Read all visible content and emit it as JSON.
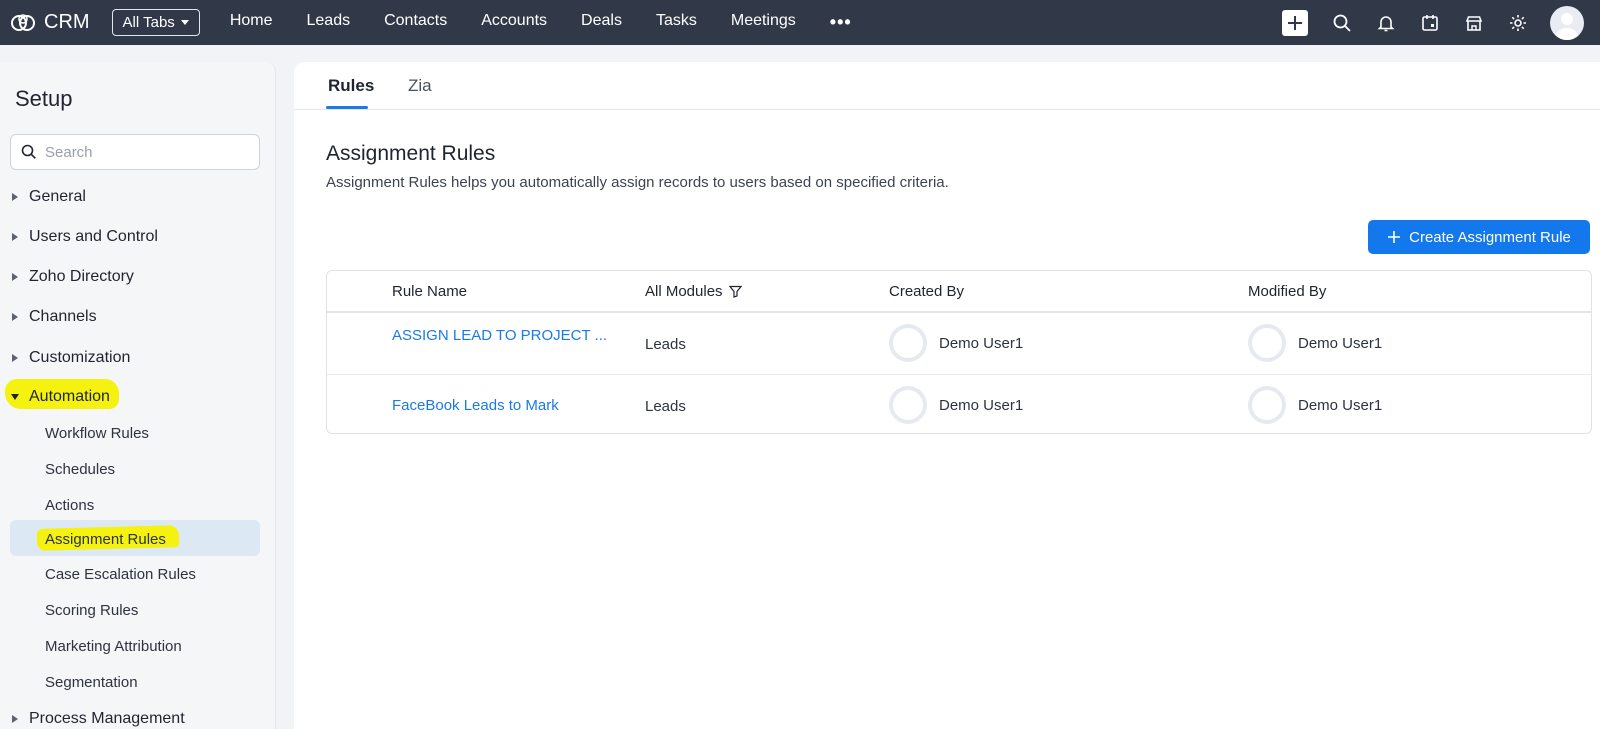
{
  "topbar": {
    "brand": "CRM",
    "all_tabs_label": "All Tabs",
    "nav": [
      "Home",
      "Leads",
      "Contacts",
      "Accounts",
      "Deals",
      "Tasks",
      "Meetings"
    ],
    "more_label": "•••",
    "icons": [
      "plus-icon",
      "search-icon",
      "bell-icon",
      "calendar-icon",
      "store-icon",
      "gear-icon",
      "avatar"
    ]
  },
  "sidebar": {
    "title": "Setup",
    "search_placeholder": "Search",
    "sections": [
      "General",
      "Users and Control",
      "Zoho Directory",
      "Channels",
      "Customization"
    ],
    "automation_label": "Automation",
    "automation_items": [
      "Workflow Rules",
      "Schedules",
      "Actions",
      "Assignment Rules",
      "Case Escalation Rules",
      "Scoring Rules",
      "Marketing Attribution",
      "Segmentation"
    ],
    "next_section": "Process Management"
  },
  "main": {
    "tabs": [
      "Rules",
      "Zia"
    ],
    "title": "Assignment Rules",
    "description": "Assignment Rules helps you automatically assign records to users based on specified criteria.",
    "create_button": "Create Assignment Rule",
    "table": {
      "headers": [
        "Rule Name",
        "All Modules",
        "Created By",
        "Modified By"
      ],
      "rows": [
        {
          "name": "ASSIGN LEAD TO PROJECT ...",
          "module": "Leads",
          "created_by": "Demo User1",
          "modified_by": "Demo User1"
        },
        {
          "name": "FaceBook Leads to Mark",
          "module": "Leads",
          "created_by": "Demo User1",
          "modified_by": "Demo User1"
        }
      ]
    }
  },
  "colors": {
    "topbar": "#313949",
    "accent": "#1378ec",
    "highlight": "#f4f20e"
  }
}
